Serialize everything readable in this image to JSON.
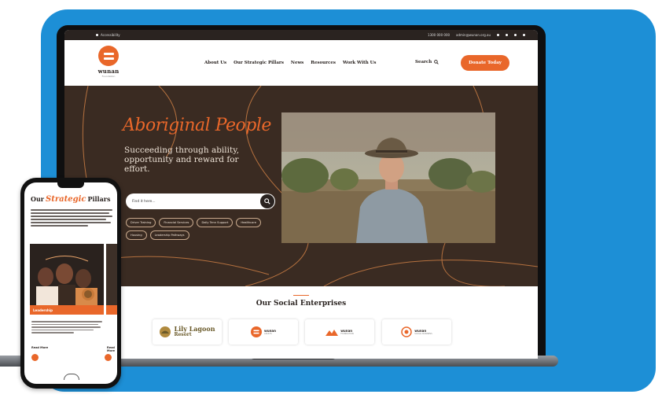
{
  "colors": {
    "background": "#1d8fd6",
    "accent": "#e9672a",
    "hero_dark": "#3a2b22",
    "text_dark": "#2a2320"
  },
  "utility_bar": {
    "accessibility_label": "Accessibility",
    "phone": "1300 000 000",
    "email": "admin@wunan.org.au"
  },
  "header": {
    "logo_text": "wunan",
    "logo_sub": "Foundation",
    "nav": [
      "About Us",
      "Our Strategic Pillars",
      "News",
      "Resources",
      "Work With Us"
    ],
    "search_label": "Search",
    "donate_label": "Donate Today"
  },
  "hero": {
    "script_title": "Aboriginal People",
    "subtitle": "Succeeding through ability, opportunity and reward for effort.",
    "search_placeholder": "Find it here...",
    "pills": [
      "Driver Training",
      "Financial Services",
      "Daily Tenn Support",
      "Healthcare",
      "Housing",
      "Leadership Pathways"
    ]
  },
  "enterprises": {
    "title": "Our Social Enterprises",
    "cards": [
      {
        "name": "Lily Lagoon",
        "sub": "Resort"
      },
      {
        "name": "wunan",
        "sub": "ADULTS"
      },
      {
        "name": "wunan",
        "sub": "FOUNDATION"
      },
      {
        "name": "wunan",
        "sub": "SOCIAL BUSINESS"
      }
    ]
  },
  "phone": {
    "title_left": "Our",
    "title_script": "Strategic",
    "title_right": "Pillars",
    "card_label": "Leadership",
    "read_more": "Read More"
  }
}
